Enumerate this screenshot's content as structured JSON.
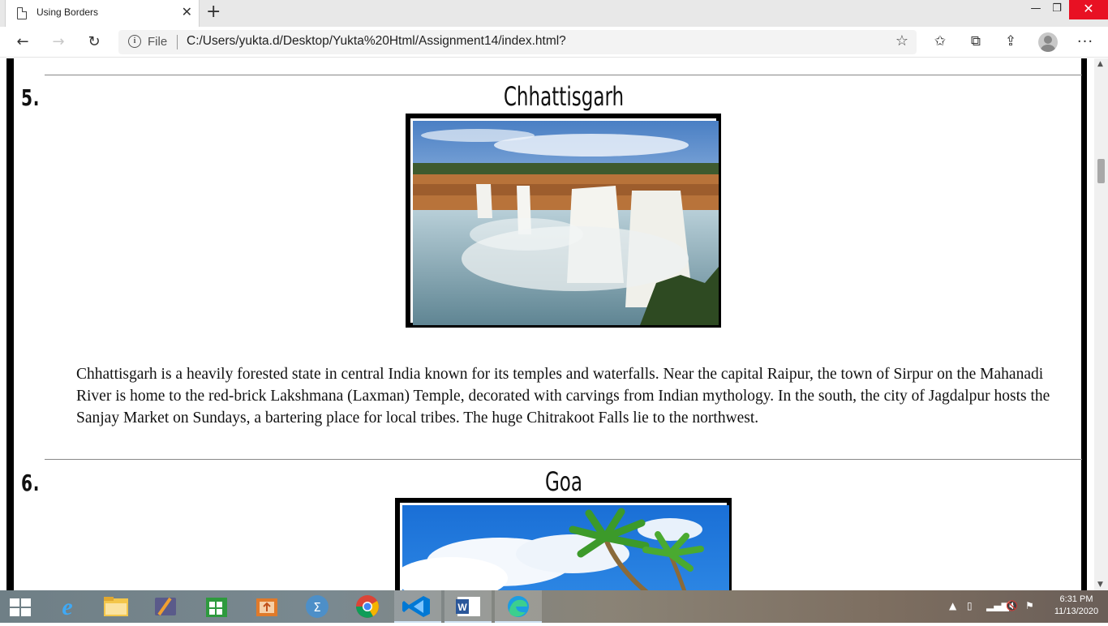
{
  "browser": {
    "tab_title": "Using Borders",
    "scheme_label": "File",
    "url": "C:/Users/yukta.d/Desktop/Yukta%20Html/Assignment14/index.html?"
  },
  "page": {
    "sections": [
      {
        "number": "5.",
        "title": "Chhattisgarh",
        "description": "Chhattisgarh is a heavily forested state in central India known for its temples and waterfalls. Near the capital Raipur, the town of Sirpur on the Mahanadi River is home to the red-brick Lakshmana (Laxman) Temple, decorated with carvings from Indian mythology. In the south, the city of Jagdalpur hosts the Sanjay Market on Sundays, a bartering place for local tribes. The huge Chitrakoot Falls lie to the northwest."
      },
      {
        "number": "6.",
        "title": "Goa"
      }
    ]
  },
  "taskbar": {
    "apps": [
      "start",
      "internet-explorer",
      "file-explorer",
      "media-player",
      "store",
      "office-upload",
      "math-input",
      "chrome",
      "vscode",
      "word",
      "edge"
    ],
    "clock_time": "6:31 PM",
    "clock_date": "11/13/2020"
  }
}
